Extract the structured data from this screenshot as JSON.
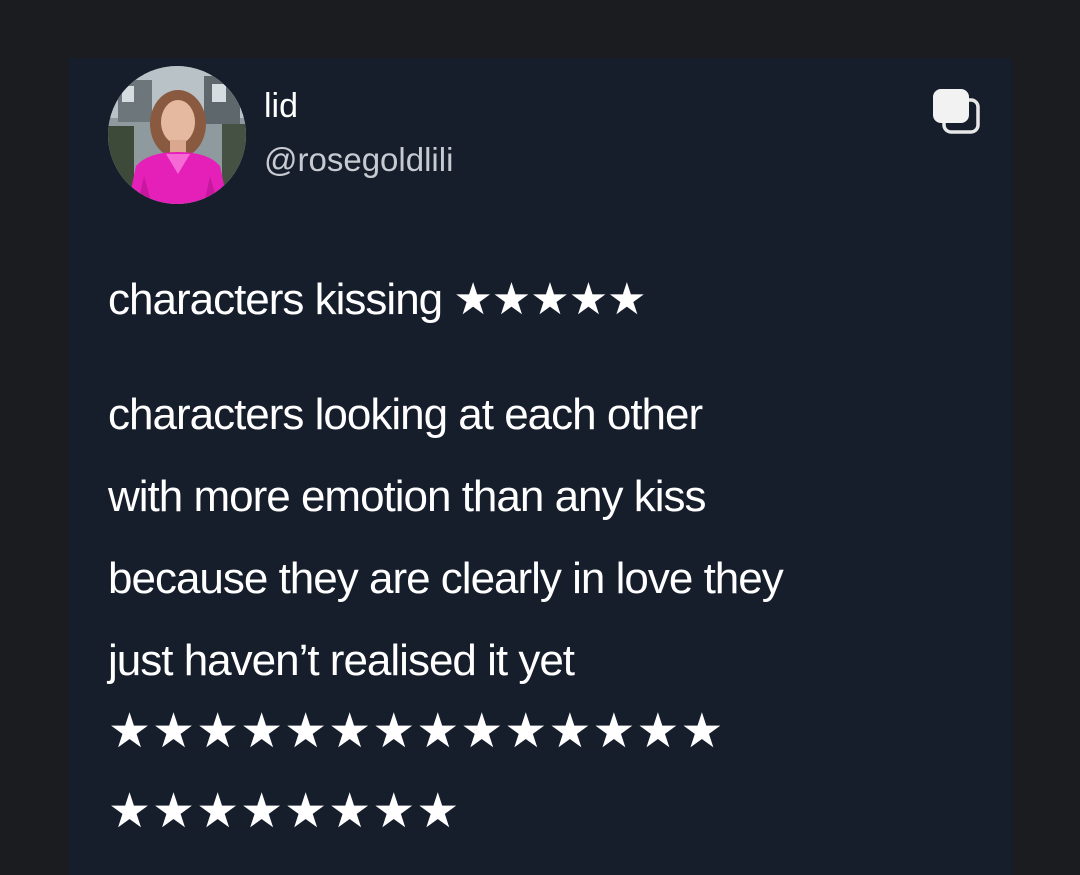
{
  "tweet": {
    "author_name": "lid",
    "author_handle": "@rosegoldlili",
    "first_line": "characters kissing ★★★★★",
    "body_lines": [
      "characters looking at each other",
      "with more emotion than any kiss",
      "because they are clearly in love they",
      "just haven’t realised it yet"
    ],
    "stars_row_1": "★★★★★★★★★★★★★★",
    "stars_row_2": "★★★★★★★★"
  },
  "icons": {
    "copy": "copy-icon",
    "avatar": "avatar"
  },
  "colors": {
    "page_background": "#1b1c20",
    "card_background": "#161d2b",
    "primary_text": "#ffffff",
    "secondary_text": "#c7cbd1"
  }
}
